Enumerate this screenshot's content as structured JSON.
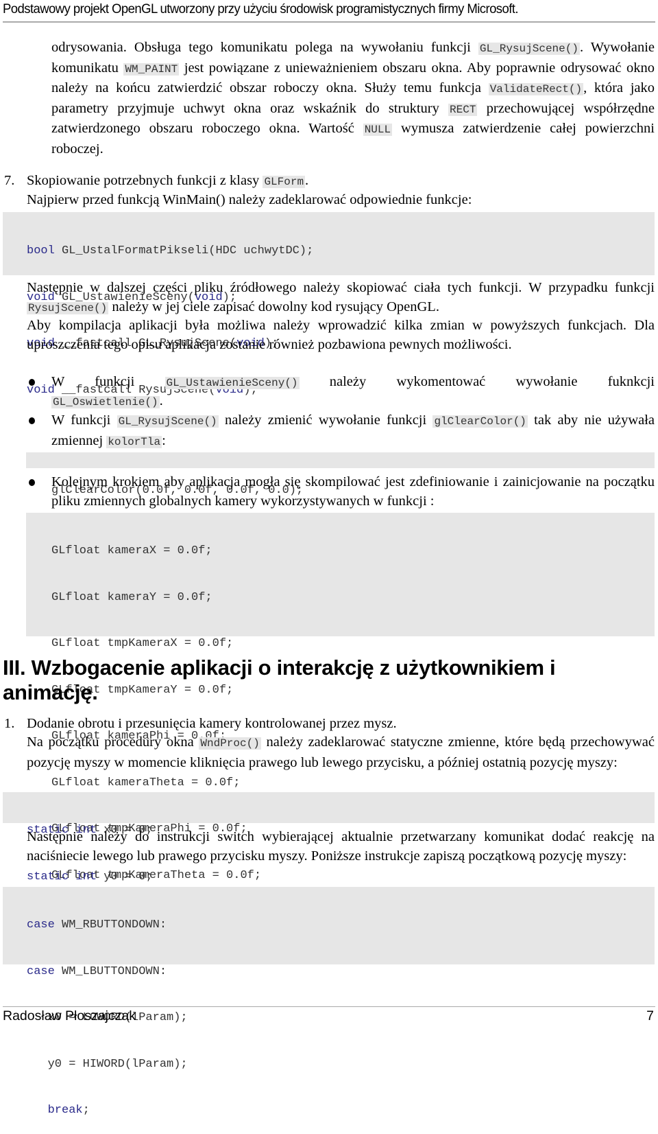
{
  "header": {
    "title": "Podstawowy projekt OpenGL utworzony przy użyciu środowisk programistycznych firmy Microsoft."
  },
  "para_top": {
    "t1": "odrysowania. Obsługa tego komunikatu polega na wywołaniu funkcji ",
    "c1": "GL_RysujScene()",
    "t2": ". Wywołanie komunikatu ",
    "c2": "WM_PAINT",
    "t3": " jest powiązane z unieważnieniem obszaru okna. Aby poprawnie odrysować okno należy na końcu zatwierdzić obszar roboczy okna. Służy temu funkcja ",
    "c3": "ValidateRect()",
    "t4": ", która jako parametry przyjmuje uchwyt okna oraz wskaźnik do struktury ",
    "c4": "RECT",
    "t5": " przechowującej współrzędne zatwierdzonego obszaru roboczego okna. Wartość ",
    "c5": "NULL",
    "t6": " wymusza zatwierdzenie całej powierzchni roboczej."
  },
  "step7": {
    "number": "7.",
    "title_text": "Skopiowanie potrzebnych funkcji z klasy ",
    "title_code": "GLForm",
    "title_end": ".",
    "intro": "Najpierw przed funkcją WinMain() należy zadeklarować odpowiednie funkcje:",
    "code_decl": [
      {
        "kw": "bool",
        "rest": " GL_UstalFormatPikseli(HDC uchwytDC);"
      },
      {
        "kw": "void",
        "rest": " GL_UstawienieSceny(",
        "kw2": "void",
        "rest2": ");"
      },
      {
        "kw": "void",
        "rest": " __fastcall GL_RysujScene(",
        "kw2": "void",
        "rest2": ");"
      },
      {
        "kw": "void",
        "rest": " __fastcall RysujScene(",
        "kw2": "void",
        "rest2": ");"
      }
    ],
    "p2_t1": "Następnie w dalszej części pliku źródłowego należy skopiować ciała tych funkcji. W przypadku funkcji ",
    "p2_c1": "RysujScene()",
    "p2_t2": " należy w jej ciele zapisać dowolny kod rysujący OpenGL.",
    "p3": "Aby kompilacja aplikacji była możliwa należy wprowadzić kilka zmian w powyższych funkcjach. Dla uproszczenia tego opisu aplikacja zostanie również pozbawiona pewnych możliwości.",
    "bullet1_t1": "W funkcji ",
    "bullet1_c1": "GL_UstawienieSceny()",
    "bullet1_t2": " należy wykomentować wywołanie fuknkcji ",
    "bullet1_c2": "GL_Oswietlenie()",
    "bullet1_t3": ".",
    "bullet2_t1": "W funkcji ",
    "bullet2_c1": "GL_RysujScene()",
    "bullet2_t2": " należy zmienić wywołanie funkcji ",
    "bullet2_c2": "glClearColor()",
    "bullet2_t3": " tak aby nie używała zmiennej ",
    "bullet2_c3": "kolorTla",
    "bullet2_t4": ":",
    "code_clear": "glClearColor(0.0f, 0.0f, 0.0f, 0.0);",
    "bullet3": "Kolejnym krokiem aby aplikacja mogła się skompilować jest zdefiniowanie i zainicjowanie na początku pliku zmiennych globalnych kamery wykorzystywanych w funkcji :",
    "code_globals": [
      "GLfloat kameraX = 0.0f;",
      "GLfloat kameraY = 0.0f;",
      "GLfloat tmpKameraX = 0.0f;",
      "GLfloat tmpKameraY = 0.0f;",
      "GLfloat kameraPhi = 0.0f;",
      "GLfloat kameraTheta = 0.0f;",
      "GLfloat tmpKameraPhi = 0.0f;",
      "GLfloat tmpKameraTheta = 0.0f;"
    ]
  },
  "section3": {
    "heading": "III.  Wzbogacenie aplikacji o interakcję z użytkownikiem i animację.",
    "step1": {
      "number": "1.",
      "title": "Dodanie obrotu i przesunięcia kamery kontrolowanej przez mysz.",
      "p1_t1": "Na początku procedury okna ",
      "p1_c1": "WndProc()",
      "p1_t2": " należy zadeklarować statyczne zmienne, które będą przechowywać pozycję myszy w momencie kliknięcia prawego lub lewego przycisku, a później ostatnią pozycję myszy:",
      "code_static": [
        {
          "kw": "static int",
          "rest": " x0 = 0;"
        },
        {
          "kw": "static int",
          "rest": " y0 = 0;"
        }
      ],
      "p2": "Następnie należy do instrukcji switch wybierającej aktualnie przetwarzany komunikat dodać reakcję na naciśniecie lewego lub prawego przycisku myszy. Poniższe instrukcje zapiszą początkową pozycję myszy:",
      "code_switch": [
        {
          "kw": "case",
          "rest": " WM_RBUTTONDOWN:"
        },
        {
          "kw": "case",
          "rest": " WM_LBUTTONDOWN:"
        },
        {
          "kw": "",
          "rest": "   x0 = LOWORD(lParam);"
        },
        {
          "kw": "",
          "rest": "   y0 = HIWORD(lParam);"
        },
        {
          "kw": "   break",
          "rest": ";"
        }
      ]
    }
  },
  "footer": {
    "author": "Radosław Płoszajczak",
    "page": "7"
  }
}
